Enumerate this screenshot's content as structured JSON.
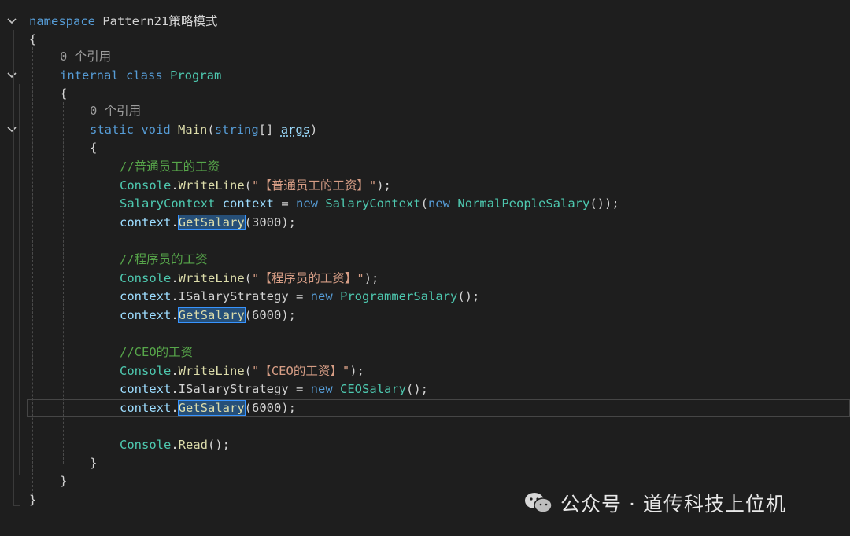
{
  "editor": {
    "l1": {
      "kw": "namespace",
      "name": "Pattern21策略模式"
    },
    "brace_open": "{",
    "brace_close": "}",
    "refs1": "0 个引用",
    "l4": {
      "kw1": "internal",
      "kw2": "class",
      "name": "Program"
    },
    "refs2": "0 个引用",
    "l7": {
      "kw1": "static",
      "kw2": "void",
      "method": "Main",
      "p1": "(",
      "kw3": "string",
      "p2": "[] ",
      "arg": "args",
      "p3": ")"
    },
    "c1": "//普通员工的工资",
    "l10": {
      "cls": "Console",
      "dot": ".",
      "method": "WriteLine",
      "open": "(",
      "str": "\"【普通员工的工资】\"",
      "close": ");"
    },
    "l11": {
      "type": "SalaryContext",
      "sp": " ",
      "var": "context",
      "eq": " = ",
      "kw": "new",
      "sp2": " ",
      "type2": "SalaryContext",
      "open": "(",
      "kw2": "new",
      "sp3": " ",
      "type3": "NormalPeopleSalary",
      "close": "());"
    },
    "l12": {
      "var": "context",
      "dot": ".",
      "method": "GetSalary",
      "open": "(",
      "num": "3000",
      "close": ");"
    },
    "c2": "//程序员的工资",
    "l15": {
      "cls": "Console",
      "dot": ".",
      "method": "WriteLine",
      "open": "(",
      "str": "\"【程序员的工资】\"",
      "close": ");"
    },
    "l16": {
      "var": "context",
      "dot": ".",
      "prop": "ISalaryStrategy",
      "eq": " = ",
      "kw": "new",
      "sp": " ",
      "type": "ProgrammerSalary",
      "close": "();"
    },
    "l17": {
      "var": "context",
      "dot": ".",
      "method": "GetSalary",
      "open": "(",
      "num": "6000",
      "close": ");"
    },
    "c3": "//CEO的工资",
    "l20": {
      "cls": "Console",
      "dot": ".",
      "method": "WriteLine",
      "open": "(",
      "str": "\"【CEO的工资】\"",
      "close": ");"
    },
    "l21": {
      "var": "context",
      "dot": ".",
      "prop": "ISalaryStrategy",
      "eq": " = ",
      "kw": "new",
      "sp": " ",
      "type": "CEOSalary",
      "close": "();"
    },
    "l22": {
      "var": "context",
      "dot": ".",
      "method": "GetSalary",
      "open": "(",
      "num": "6000",
      "close": ");"
    },
    "l24": {
      "cls": "Console",
      "dot": ".",
      "method": "Read",
      "close": "();"
    }
  },
  "watermark": {
    "text": "公众号 · 道传科技上位机",
    "icon": "wechat-icon"
  },
  "colors": {
    "background": "#1e1e1e",
    "keyword": "#569cd6",
    "type": "#4ec9b0",
    "method": "#dcdcaa",
    "string": "#d69d85",
    "comment": "#57a64a",
    "variable": "#9cdcfe",
    "highlight": "#264f78"
  }
}
